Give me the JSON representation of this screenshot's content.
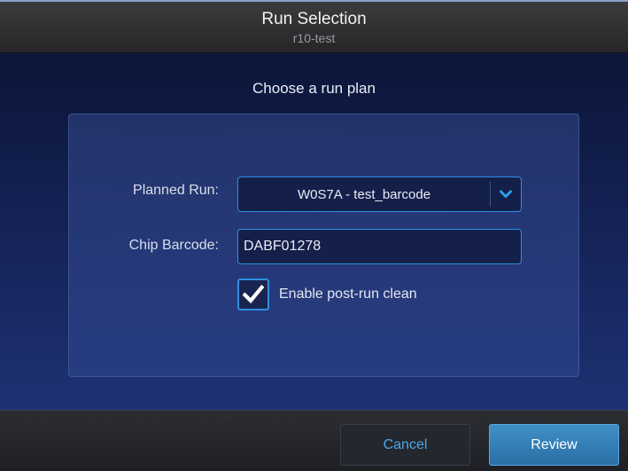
{
  "header": {
    "title": "Run Selection",
    "subtitle": "r10-test"
  },
  "main": {
    "prompt": "Choose a run plan",
    "planned_run": {
      "label": "Planned Run:",
      "value": "W0S7A - test_barcode"
    },
    "chip_barcode": {
      "label": "Chip Barcode:",
      "value": "DABF01278"
    },
    "post_run_clean": {
      "label": "Enable post-run clean",
      "checked": true
    }
  },
  "footer": {
    "cancel_label": "Cancel",
    "review_label": "Review"
  },
  "colors": {
    "accent": "#2f8fe0",
    "header_bg": "#2f2f31",
    "main_bg": "#16245a",
    "review_button": "#3584bd",
    "cancel_text": "#4da6e8"
  },
  "icons": {
    "dropdown": "chevron-down-icon",
    "checkbox": "checkmark-icon"
  }
}
